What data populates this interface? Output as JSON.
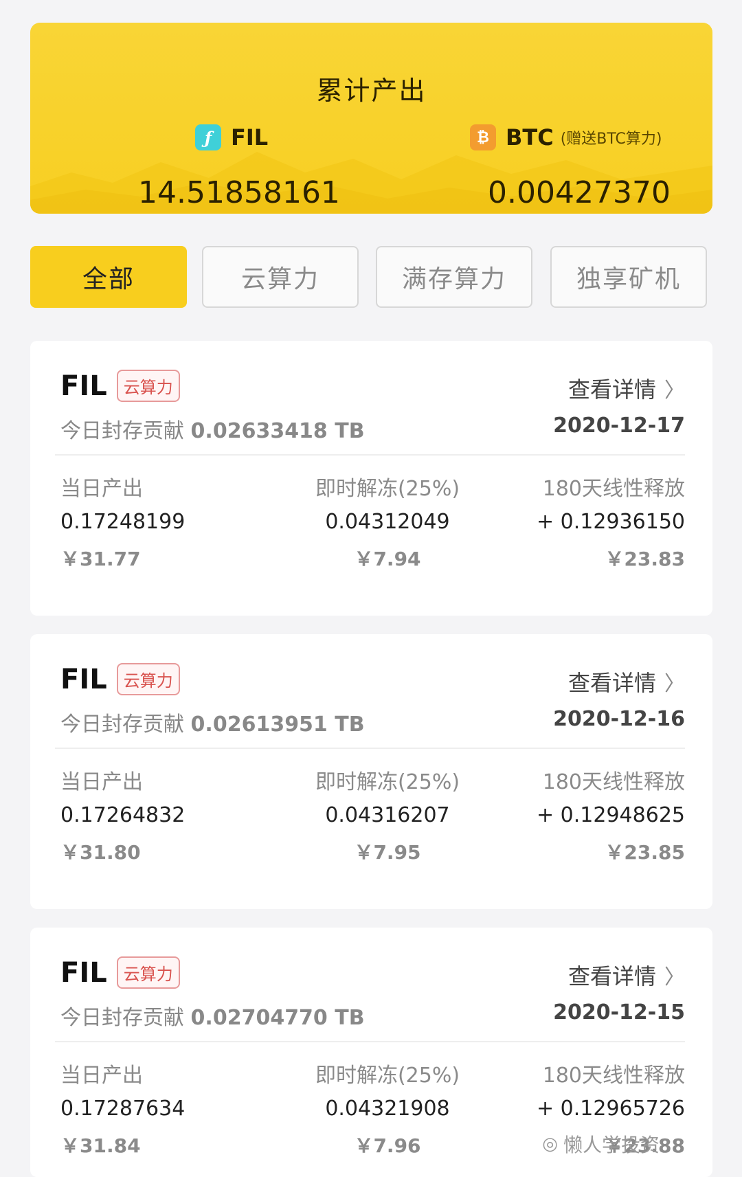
{
  "summary": {
    "title": "累计产出",
    "fil": {
      "icon": "filecoin-icon",
      "symbol": "FIL",
      "value": "14.51858161"
    },
    "btc": {
      "icon": "bitcoin-icon",
      "symbol": "BTC",
      "note": "(赠送BTC算力)",
      "value": "0.00427370"
    }
  },
  "tabs": [
    {
      "label": "全部",
      "active": true
    },
    {
      "label": "云算力",
      "active": false
    },
    {
      "label": "满存算力",
      "active": false
    },
    {
      "label": "独享矿机",
      "active": false
    }
  ],
  "columns": {
    "daily": "当日产出",
    "instant": "即时解冻(25%)",
    "linear": "180天线性释放"
  },
  "records": [
    {
      "coin": "FIL",
      "badge": "云算力",
      "link": "查看详情",
      "sub_label": "今日封存贡献",
      "sub_value": "0.02633418 TB",
      "date": "2020-12-17",
      "daily": "0.17248199",
      "daily_rmb": "￥31.77",
      "instant": "0.04312049",
      "instant_rmb": "￥7.94",
      "linear": "+ 0.12936150",
      "linear_rmb": "￥23.83"
    },
    {
      "coin": "FIL",
      "badge": "云算力",
      "link": "查看详情",
      "sub_label": "今日封存贡献",
      "sub_value": "0.02613951 TB",
      "date": "2020-12-16",
      "daily": "0.17264832",
      "daily_rmb": "￥31.80",
      "instant": "0.04316207",
      "instant_rmb": "￥7.95",
      "linear": "+ 0.12948625",
      "linear_rmb": "￥23.85"
    },
    {
      "coin": "FIL",
      "badge": "云算力",
      "link": "查看详情",
      "sub_label": "今日封存贡献",
      "sub_value": "0.02704770 TB",
      "date": "2020-12-15",
      "daily": "0.17287634",
      "daily_rmb": "￥31.84",
      "instant": "0.04321908",
      "instant_rmb": "￥7.96",
      "linear": "+ 0.12965726",
      "linear_rmb": "￥23.88"
    }
  ],
  "watermark": "懒人学投资",
  "colors": {
    "accent": "#f8ce1e",
    "badge": "#d9534f"
  }
}
